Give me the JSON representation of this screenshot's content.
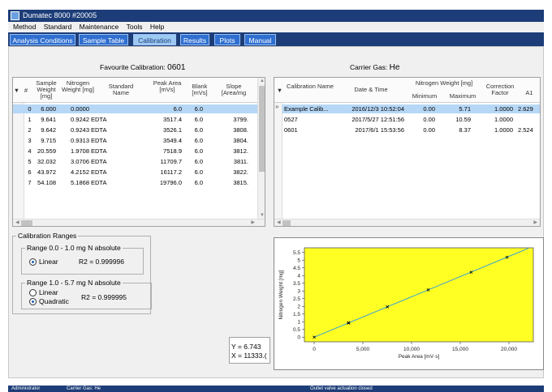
{
  "window": {
    "title": "Dumatec 8000 #20005"
  },
  "menu": [
    "Method",
    "Standard",
    "Maintenance",
    "Tools",
    "Help"
  ],
  "tabs": [
    {
      "label": "Analysis Conditions"
    },
    {
      "label": "Sample Table"
    },
    {
      "label": "Calibration",
      "active": true
    },
    {
      "label": "Results"
    },
    {
      "label": "Plots"
    },
    {
      "label": "Manual"
    }
  ],
  "favourite": {
    "label": "Favourite Calibration:",
    "value": "0601"
  },
  "carrier": {
    "label": "Carrier Gas:",
    "value": "He"
  },
  "left_table": {
    "columns": [
      "#",
      "Sample Weight [mg]",
      "Nitrogen Weight [mg]",
      "Standard Name",
      "Peak Area [mVs]",
      "Blank [mVs]",
      "Slope [Area/mg"
    ],
    "rows": [
      {
        "n": "0",
        "sample_weight": "6.000",
        "nitrogen_weight": "0.0000",
        "standard": "",
        "peak_area": "6.0",
        "blank": "6.0",
        "slope": ""
      },
      {
        "n": "1",
        "sample_weight": "9.641",
        "nitrogen_weight": "0.9242",
        "standard": "EDTA",
        "peak_area": "3517.4",
        "blank": "6.0",
        "slope": "3799."
      },
      {
        "n": "2",
        "sample_weight": "9.642",
        "nitrogen_weight": "0.9243",
        "standard": "EDTA",
        "peak_area": "3526.1",
        "blank": "6.0",
        "slope": "3808."
      },
      {
        "n": "3",
        "sample_weight": "9.715",
        "nitrogen_weight": "0.9313",
        "standard": "EDTA",
        "peak_area": "3549.4",
        "blank": "6.0",
        "slope": "3804."
      },
      {
        "n": "4",
        "sample_weight": "20.559",
        "nitrogen_weight": "1.9708",
        "standard": "EDTA",
        "peak_area": "7518.9",
        "blank": "6.0",
        "slope": "3812."
      },
      {
        "n": "5",
        "sample_weight": "32.032",
        "nitrogen_weight": "3.0706",
        "standard": "EDTA",
        "peak_area": "11709.7",
        "blank": "6.0",
        "slope": "3811."
      },
      {
        "n": "6",
        "sample_weight": "43.972",
        "nitrogen_weight": "4.2152",
        "standard": "EDTA",
        "peak_area": "16117.2",
        "blank": "6.0",
        "slope": "3822."
      },
      {
        "n": "7",
        "sample_weight": "54.108",
        "nitrogen_weight": "5.1868",
        "standard": "EDTA",
        "peak_area": "19796.0",
        "blank": "6.0",
        "slope": "3815."
      }
    ]
  },
  "right_table": {
    "columns": {
      "name": "Calibration Name",
      "datetime": "Date & Time",
      "nitrogen_group": "Nitrogen Weight [mg]",
      "min": "Minimum",
      "max": "Maximum",
      "factor": "Correction Factor",
      "a1": "A1"
    },
    "rows": [
      {
        "name": "Example Calib...",
        "datetime": "2016/12/3 10:52:04",
        "min": "0.00",
        "max": "5.71",
        "factor": "1.0000",
        "a1": "2.629"
      },
      {
        "name": "0527",
        "datetime": "2017/5/27 12:51:56",
        "min": "0.00",
        "max": "10.59",
        "factor": "1.0000",
        "a1": ""
      },
      {
        "name": "0601",
        "datetime": "2017/6/1 15:53:56",
        "min": "0.00",
        "max": "8.37",
        "factor": "1.0000",
        "a1": "2.524"
      }
    ]
  },
  "ranges": {
    "title": "Calibration Ranges",
    "range1": {
      "title": "Range 0.0 - 1.0 mg N absolute",
      "option": "Linear",
      "r2": "R2 = 0.999996"
    },
    "range2": {
      "title": "Range 1.0 - 5.7 mg N absolute",
      "option1": "Linear",
      "option2": "Quadratic",
      "r2": "R2 = 0.999995"
    }
  },
  "readout": {
    "y": "Y = 6.743",
    "x": "X = 11333.("
  },
  "chart_data": {
    "type": "scatter",
    "title": "",
    "xlabel": "Peak Area [mV·s]",
    "ylabel": "Nitrogen Weight [mg]",
    "xlim": [
      -1000,
      22500
    ],
    "ylim": [
      -0.3,
      5.8
    ],
    "xticks": [
      0,
      5000,
      10000,
      15000,
      20000
    ],
    "xtick_labels": [
      "0",
      "5,000",
      "10,000",
      "15,000",
      "20,000"
    ],
    "yticks": [
      0,
      0.5,
      1,
      1.5,
      2,
      2.5,
      3,
      3.5,
      4,
      4.5,
      5,
      5.5
    ],
    "ytick_labels": [
      "0",
      "0.5",
      "1",
      "1.5",
      "2",
      "2.5",
      "3",
      "3.5",
      "4",
      "4.5",
      "5",
      "5.5"
    ],
    "points": [
      {
        "x": 6.0,
        "y": 0.0
      },
      {
        "x": 3517.4,
        "y": 0.9242
      },
      {
        "x": 3526.1,
        "y": 0.9243
      },
      {
        "x": 3549.4,
        "y": 0.9313
      },
      {
        "x": 7518.9,
        "y": 1.9708
      },
      {
        "x": 11709.7,
        "y": 3.0706
      },
      {
        "x": 16117.2,
        "y": 4.2152
      },
      {
        "x": 19796.0,
        "y": 5.1868
      }
    ],
    "fit_line": [
      {
        "x": 0,
        "y": 0.0
      },
      {
        "x": 22000,
        "y": 5.77
      }
    ],
    "colors": {
      "plot_bg": "#ffff24",
      "fit_line": "#3aa0d8",
      "points": "#000000"
    }
  },
  "status": {
    "user": "Administrator",
    "carrier": "Carrier Gas: He",
    "message": "Outlet valve actuation closed"
  },
  "colors": {
    "title_bar": "#1c3d78",
    "tab": "#2f6fd0",
    "tab_active": "#9dc9f2",
    "selection": "#b7d7f6"
  }
}
